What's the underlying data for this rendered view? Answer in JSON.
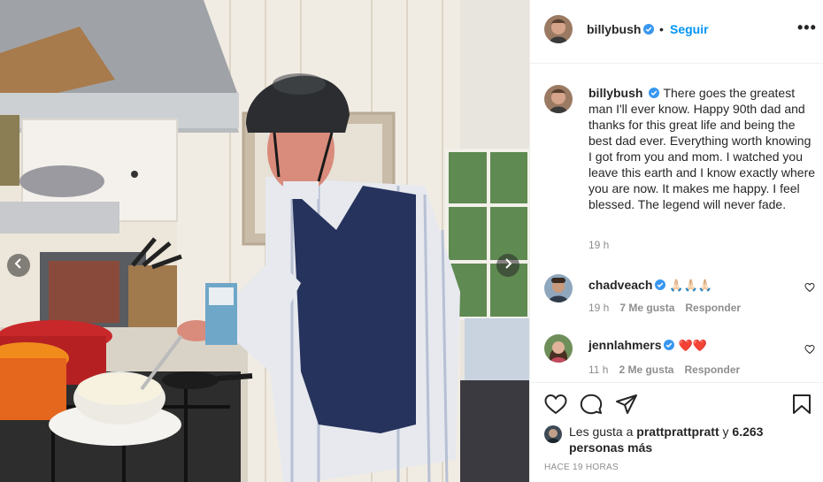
{
  "post": {
    "image_alt": "",
    "author": "billybush",
    "verified": true,
    "follow_label": "Seguir",
    "separator": "•",
    "more_label": "•••"
  },
  "caption": {
    "author": "billybush",
    "text": "There goes the greatest man I'll ever know. Happy 90th dad and thanks for this great life and being the best dad ever. Everything worth knowing I got from you and mom. I watched you leave this earth and I know exactly where you are now. It makes me happy. I feel blessed. The legend will never fade.",
    "time": "19 h"
  },
  "comments": [
    {
      "author": "chadveach",
      "text": "🙏🏻🙏🏻🙏🏻",
      "time": "19 h",
      "likes": "7 Me gusta",
      "reply": "Responder"
    },
    {
      "author": "jennlahmers",
      "text": "❤️❤️",
      "time": "11 h",
      "likes": "2 Me gusta",
      "reply": "Responder"
    }
  ],
  "likes": {
    "prefix": "Les gusta a",
    "user": "prattprattpratt",
    "connector": "y",
    "others": "6.263 personas más"
  },
  "timestamp": "HACE 19 HORAS",
  "icons": {
    "like": "heart-icon",
    "comment": "comment-icon",
    "share": "paper-plane-icon",
    "save": "bookmark-icon",
    "verified": "verified-badge-icon",
    "prev": "chevron-left-icon",
    "next": "chevron-right-icon"
  },
  "colors": {
    "accent": "#0095f6",
    "verified": "#3897f0",
    "muted": "#8e8e8e",
    "text": "#262626"
  }
}
